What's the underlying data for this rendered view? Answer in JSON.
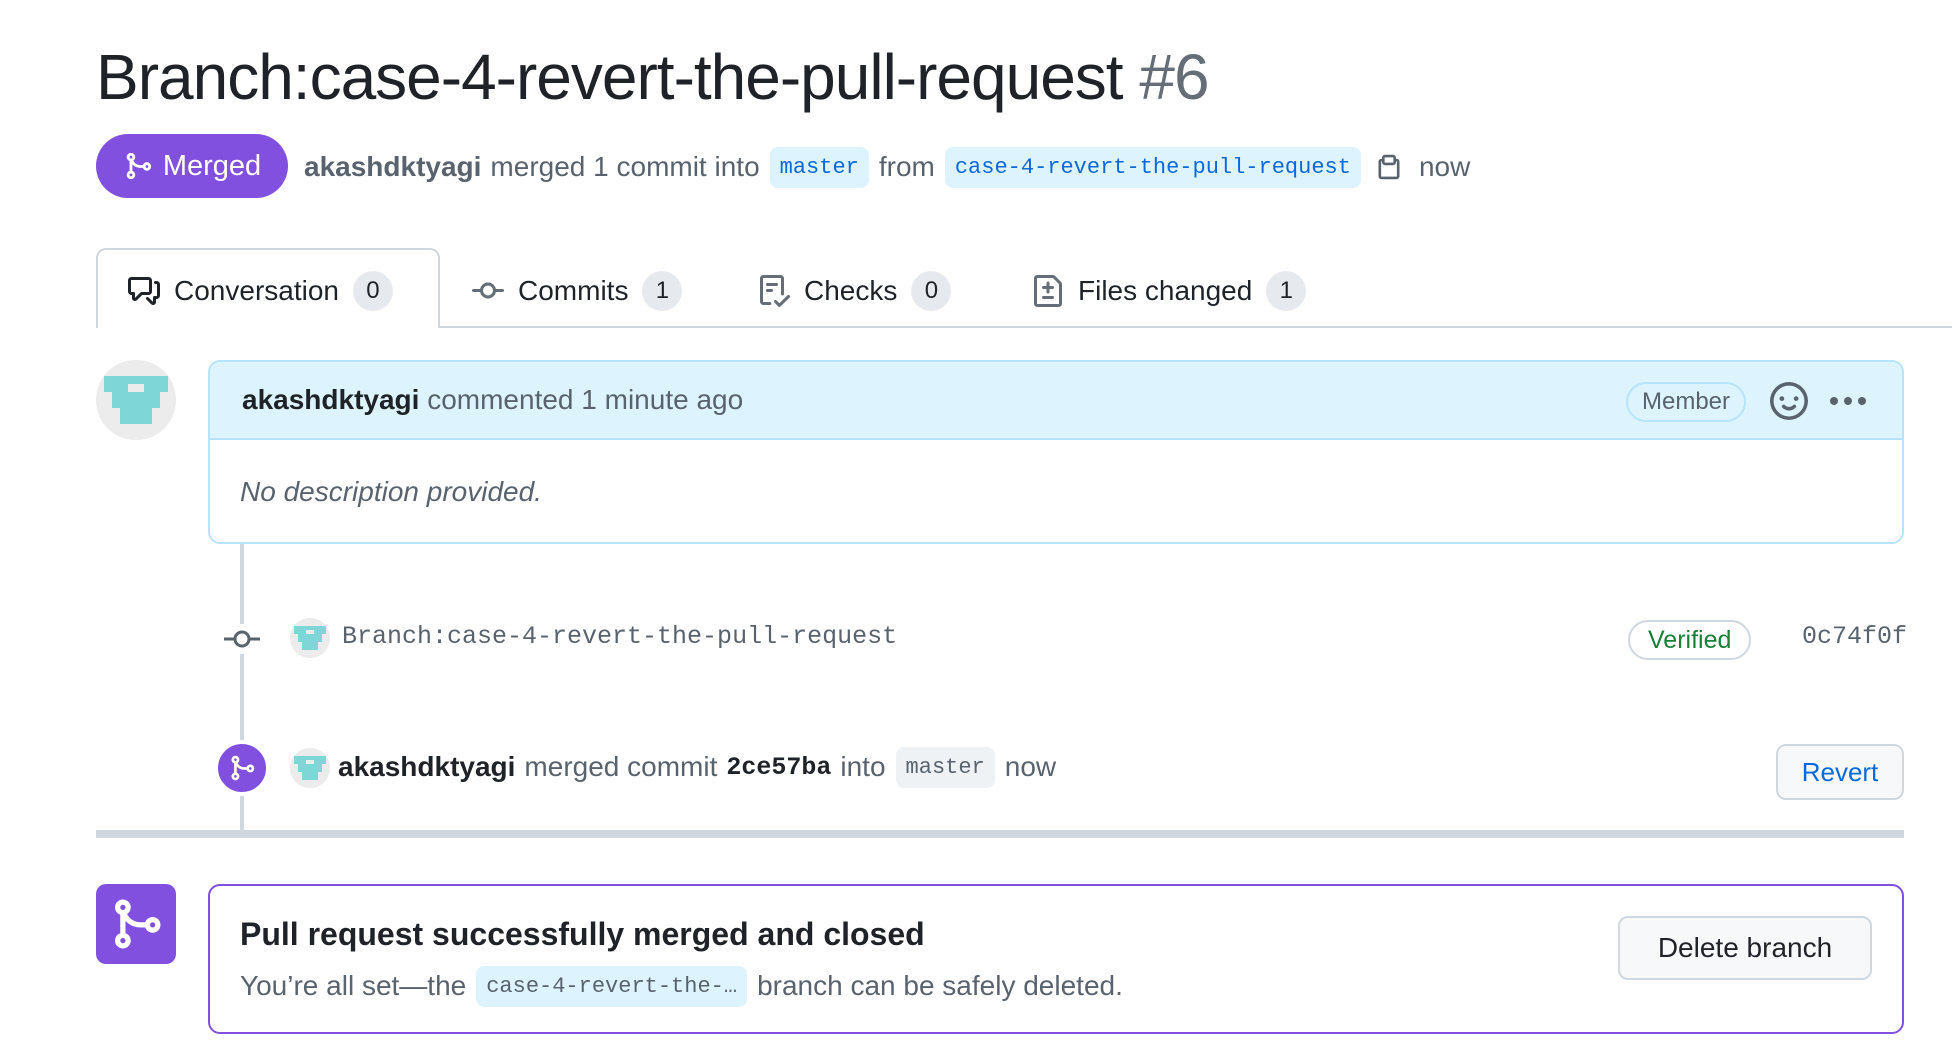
{
  "header": {
    "title": "Branch:case-4-revert-the-pull-request",
    "number": "#6",
    "state_label": "Merged",
    "author": "akashdktyagi",
    "merge_text": "merged 1 commit into",
    "base_branch": "master",
    "from_text": "from",
    "head_branch": "case-4-revert-the-pull-request",
    "time": "now"
  },
  "tabs": [
    {
      "label": "Conversation",
      "count": "0",
      "icon": "comment-discussion-icon"
    },
    {
      "label": "Commits",
      "count": "1",
      "icon": "git-commit-icon"
    },
    {
      "label": "Checks",
      "count": "0",
      "icon": "checklist-icon"
    },
    {
      "label": "Files changed",
      "count": "1",
      "icon": "file-diff-icon"
    }
  ],
  "comment": {
    "author": "akashdktyagi",
    "action": "commented 1 minute ago",
    "role_badge": "Member",
    "body": "No description provided."
  },
  "commit": {
    "message": "Branch:case-4-revert-the-pull-request",
    "verified_label": "Verified",
    "sha": "0c74f0f"
  },
  "merge_event": {
    "author": "akashdktyagi",
    "text": "merged commit",
    "sha": "2ce57ba",
    "into_text": "into",
    "branch": "master",
    "time": "now",
    "revert_label": "Revert"
  },
  "merged_box": {
    "title": "Pull request successfully merged and closed",
    "prefix": "You’re all set—the",
    "branch": "case-4-revert-the-…",
    "suffix": "branch can be safely deleted.",
    "delete_label": "Delete branch"
  },
  "colors": {
    "merged_purple": "#8250df",
    "link_blue": "#0969da",
    "verified_green": "#1a7f37",
    "avatar_teal": "#7ed6d6"
  }
}
